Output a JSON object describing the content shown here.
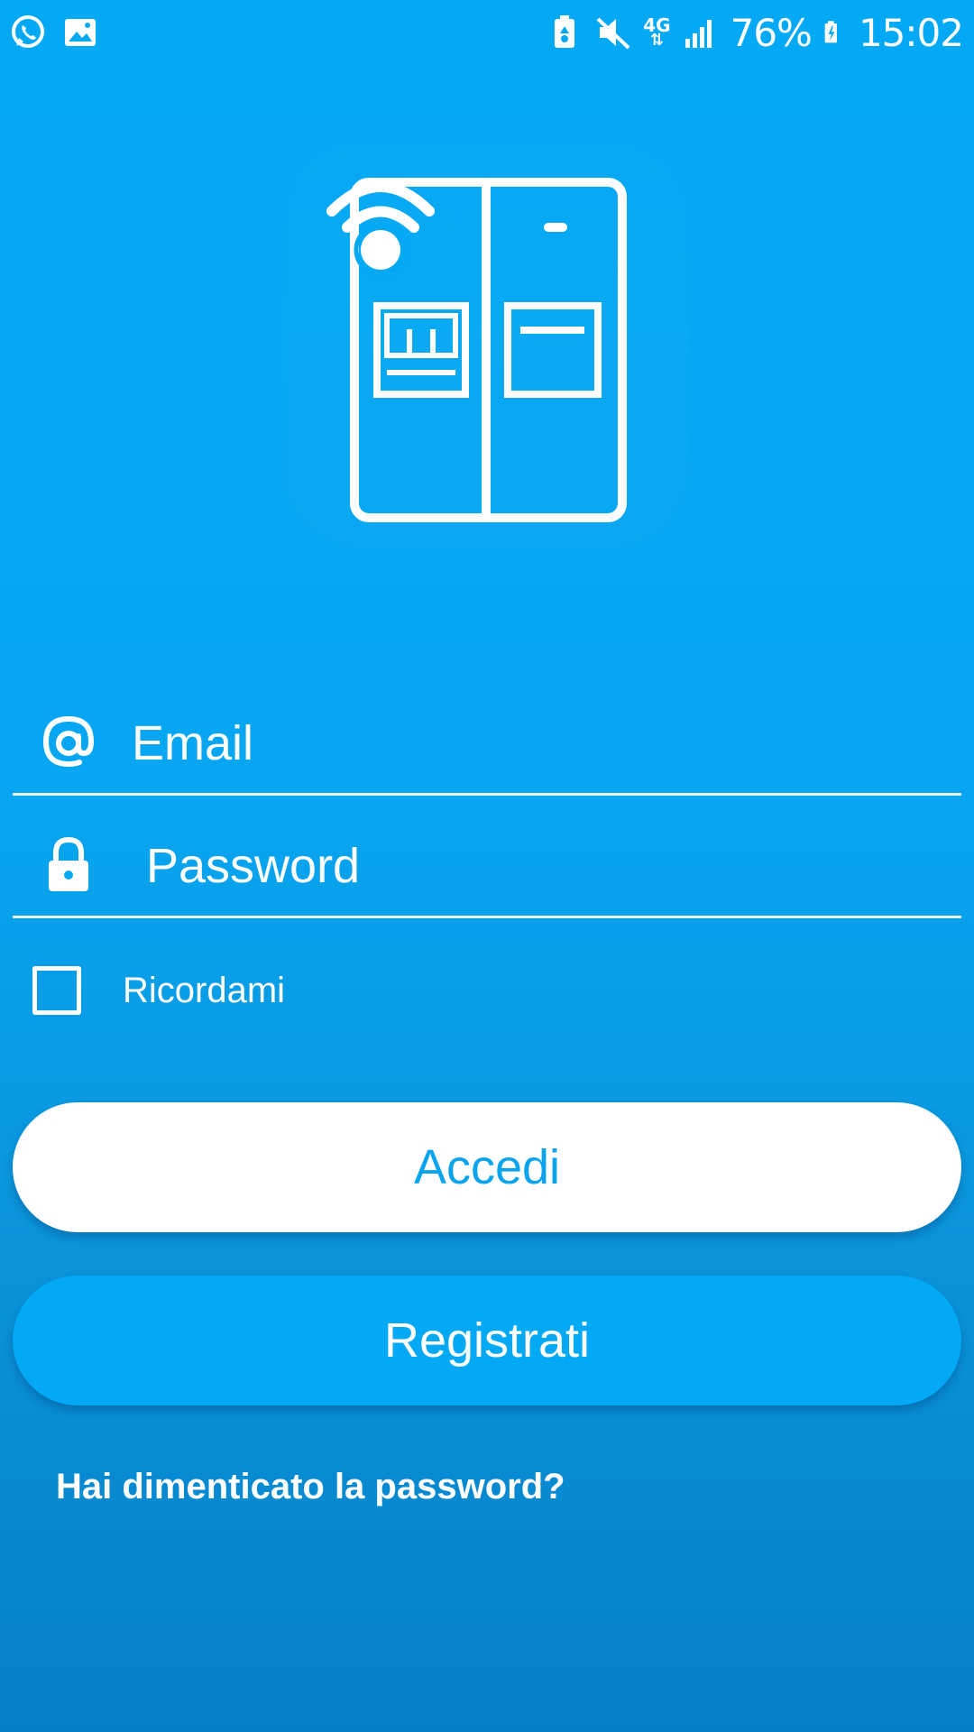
{
  "status_bar": {
    "left_icons": [
      "whatsapp-icon",
      "gallery-icon"
    ],
    "right_icons": [
      "battery-saver-icon",
      "mute-icon",
      "network-icon",
      "signal-icon",
      "battery-charging-icon"
    ],
    "network_label": "4G",
    "battery": "76%",
    "time": "15:02"
  },
  "logo": {
    "icon": "smart-fridge-wifi-logo"
  },
  "form": {
    "email": {
      "placeholder": "Email",
      "value": "",
      "icon": "at-icon"
    },
    "password": {
      "placeholder": "Password",
      "value": "",
      "icon": "lock-icon"
    },
    "remember": {
      "label": "Ricordami",
      "checked": false
    }
  },
  "buttons": {
    "login": "Accedi",
    "register": "Registrati"
  },
  "forgot_password": "Hai dimenticato la password?",
  "colors": {
    "background_top": "#03a9f4",
    "background_bottom": "#0480c8",
    "login_text": "#0aa4ee",
    "register_bg": "#03a9f4"
  }
}
